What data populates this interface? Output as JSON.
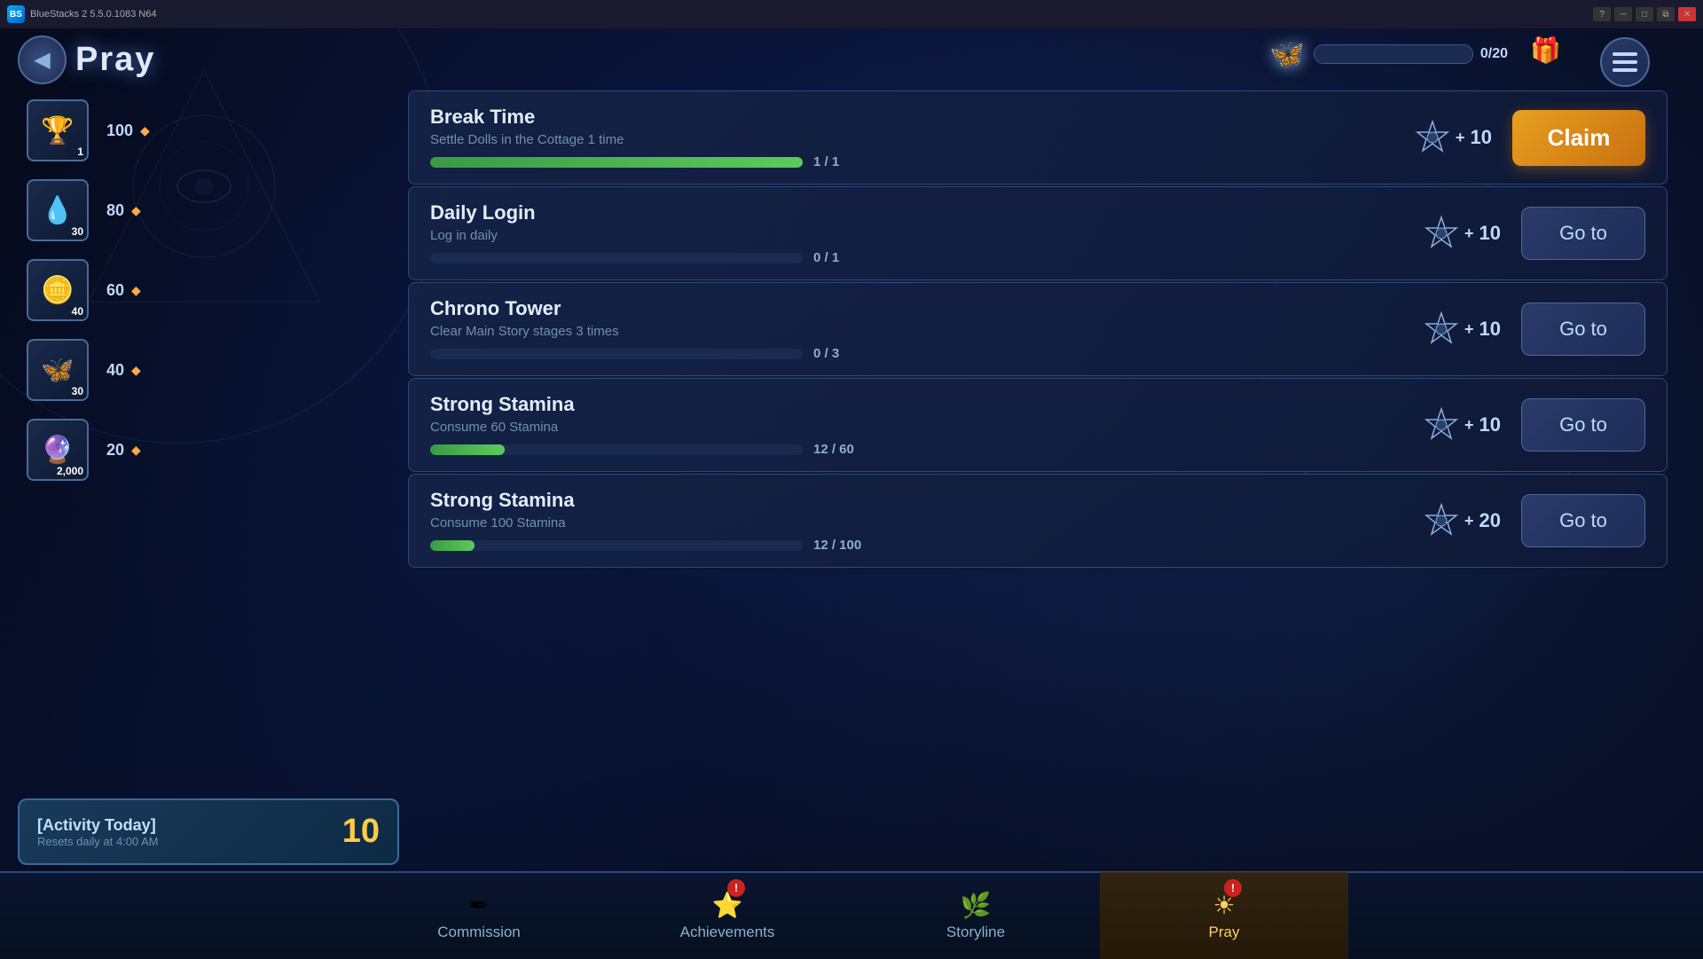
{
  "app": {
    "title": "BlueStacks 2  5.5.0.1083  N64",
    "logo": "BS"
  },
  "titlebar": {
    "controls": [
      "help",
      "minimize",
      "maximize",
      "restore",
      "close"
    ]
  },
  "header": {
    "back_label": "◀",
    "title": "Pray",
    "butterfly_progress": "0/20",
    "butterfly_progress_pct": 0
  },
  "sidebar": {
    "rewards": [
      {
        "icon": "🏆",
        "count": "1",
        "milestone": 100,
        "id": "reward-trophy"
      },
      {
        "icon": "💧",
        "count": "30",
        "milestone": 80,
        "id": "reward-drop"
      },
      {
        "icon": "🪙",
        "count": "40",
        "milestone": 60,
        "id": "reward-coin"
      },
      {
        "icon": "🦋",
        "count": "30",
        "milestone": 40,
        "id": "reward-butterfly"
      },
      {
        "icon": "🔮",
        "count": "2,000",
        "milestone": 20,
        "id": "reward-orb"
      }
    ]
  },
  "activity": {
    "title": "[Activity Today]",
    "subtitle": "Resets daily at 4:00 AM",
    "score": "10"
  },
  "tasks": [
    {
      "id": "break-time",
      "name": "Break Time",
      "desc": "Settle Dolls in the Cottage 1 time",
      "reward": 10,
      "progress_current": 1,
      "progress_max": 1,
      "progress_pct": 100,
      "action": "Claim",
      "action_type": "claim"
    },
    {
      "id": "daily-login",
      "name": "Daily Login",
      "desc": "Log in daily",
      "reward": 10,
      "progress_current": 0,
      "progress_max": 1,
      "progress_pct": 0,
      "action": "Go to",
      "action_type": "goto"
    },
    {
      "id": "chrono-tower",
      "name": "Chrono Tower",
      "desc": "Clear Main Story stages 3 times",
      "reward": 10,
      "progress_current": 0,
      "progress_max": 3,
      "progress_pct": 0,
      "action": "Go to",
      "action_type": "goto"
    },
    {
      "id": "strong-stamina-1",
      "name": "Strong Stamina",
      "desc": "Consume 60 Stamina",
      "reward": 10,
      "progress_current": 12,
      "progress_max": 60,
      "progress_pct": 20,
      "action": "Go to",
      "action_type": "goto"
    },
    {
      "id": "strong-stamina-2",
      "name": "Strong Stamina",
      "desc": "Consume 100 Stamina",
      "reward": 20,
      "progress_current": 12,
      "progress_max": 100,
      "progress_pct": 12,
      "action": "Go to",
      "action_type": "goto"
    }
  ],
  "bottom_nav": {
    "items": [
      {
        "id": "commission",
        "label": "Commission",
        "icon": "✒",
        "active": false,
        "badge": false
      },
      {
        "id": "achievements",
        "label": "Achievements",
        "icon": "⭐",
        "active": false,
        "badge": true
      },
      {
        "id": "storyline",
        "label": "Storyline",
        "icon": "🌿",
        "active": false,
        "badge": false
      },
      {
        "id": "pray",
        "label": "Pray",
        "icon": "☀",
        "active": true,
        "badge": true
      }
    ]
  },
  "labels": {
    "goto": "Go to",
    "claim": "Claim"
  }
}
